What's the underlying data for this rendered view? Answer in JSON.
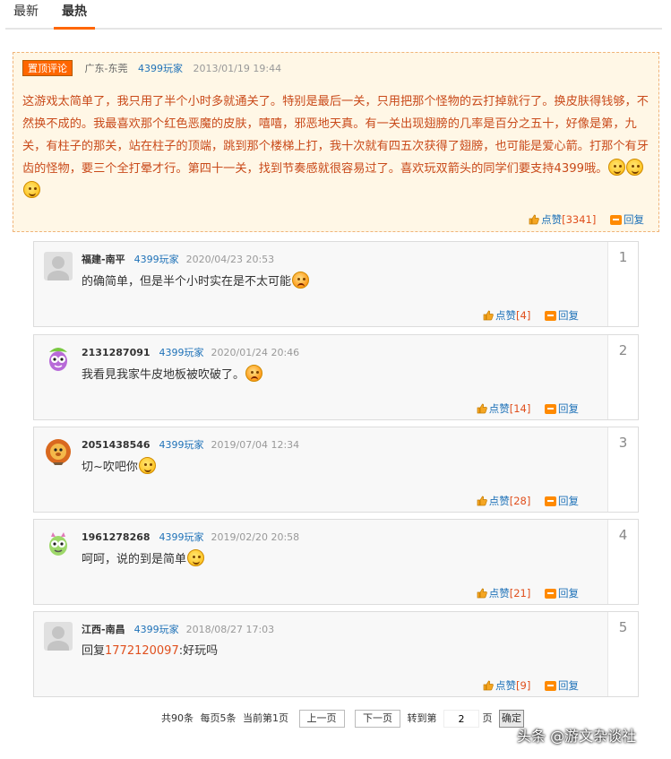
{
  "tabs": [
    {
      "label": "最新"
    },
    {
      "label": "最热"
    }
  ],
  "active_tab": "最热",
  "pinned": {
    "badge": "置顶评论",
    "location": "广东-东莞",
    "user_tag": "4399玩家",
    "time": "2013/01/19 19:44",
    "text": "这游戏太简单了，我只用了半个小时多就通关了。特别是最后一关，只用把那个怪物的云打掉就行了。换皮肤得钱够，不然换不成的。我最喜欢那个红色恶魔的皮肤，嘻嘻，邪恶地天真。有一关出现翅膀的几率是百分之五十，好像是第，九关，有柱子的那关，站在柱子的顶端，跳到那个楼梯上打，我十次就有四五次获得了翅膀，也可能是爱心箭。打那个有牙齿的怪物，要三个全打晕才行。第四十一关，找到节奏感就很容易过了。喜欢玩双箭头的同学们要支持4399哦。",
    "emoji": [
      "smile-icon",
      "smile-icon",
      "smile-icon"
    ],
    "like_label": "点赞",
    "like_count": "[3341]",
    "reply_label": "回复"
  },
  "replies": [
    {
      "name": "福建-南平",
      "user_tag": "4399玩家",
      "time": "2020/04/23 20:53",
      "text": "的确简单，但是半个小时实在是不太可能",
      "emoji": "angry-face-icon",
      "like_label": "点赞",
      "like_count": "[4]",
      "reply_label": "回复",
      "floor": "1",
      "avatar": "default-avatar"
    },
    {
      "name": "2131287091",
      "user_tag": "4399玩家",
      "time": "2020/01/24 20:46",
      "text": "我看見我家牛皮地板被吹破了。",
      "emoji": "angry-face-icon",
      "like_label": "点赞",
      "like_count": "[14]",
      "reply_label": "回复",
      "floor": "2",
      "avatar": "cartoon-avatar"
    },
    {
      "name": "2051438546",
      "user_tag": "4399玩家",
      "time": "2019/07/04 12:34",
      "text": "切~吹吧你",
      "emoji": "sweat-face-icon",
      "like_label": "点赞",
      "like_count": "[28]",
      "reply_label": "回复",
      "floor": "3",
      "avatar": "lion-avatar"
    },
    {
      "name": "1961278268",
      "user_tag": "4399玩家",
      "time": "2019/02/20 20:58",
      "text": "呵呵，说的到是简单",
      "emoji": "shocked-face-icon",
      "like_label": "点赞",
      "like_count": "[21]",
      "reply_label": "回复",
      "floor": "4",
      "avatar": "cartoon-avatar"
    },
    {
      "name": "江西-南昌",
      "user_tag": "4399玩家",
      "time": "2018/08/27 17:03",
      "text_prefix": "回复",
      "text_ref": "1772120097",
      "text_suffix": ":好玩吗",
      "like_label": "点赞",
      "like_count": "[9]",
      "reply_label": "回复",
      "floor": "5",
      "avatar": "default-avatar"
    }
  ],
  "pager": {
    "total": "共90条",
    "per_page": "每页5条",
    "current": "当前第1页",
    "prev": "上一页",
    "next": "下一页",
    "goto_label": "转到第",
    "goto_value": "2",
    "page_unit": "页",
    "ok": "确定"
  },
  "watermark": "头条 @游文杂谈社"
}
